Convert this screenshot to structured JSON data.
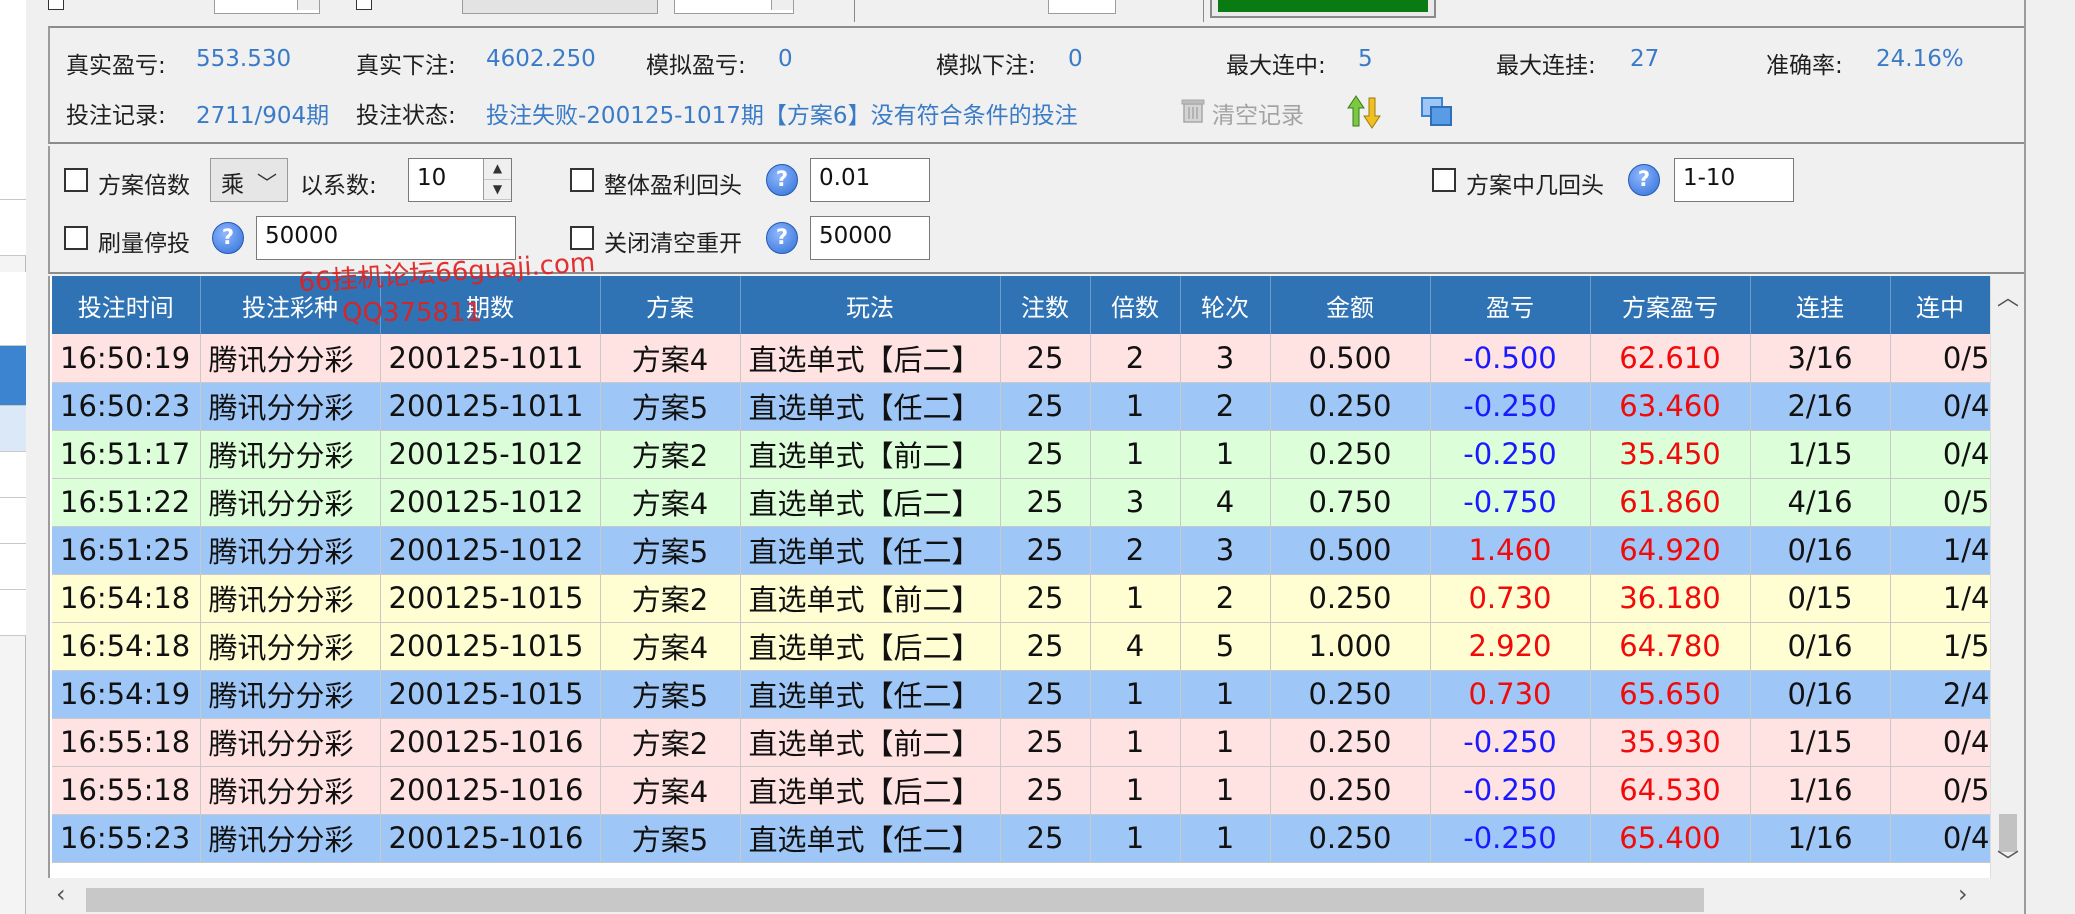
{
  "stats": {
    "real_pl_label": "真实盈亏:",
    "real_pl_value": "553.530",
    "real_bet_label": "真实下注:",
    "real_bet_value": "4602.250",
    "sim_pl_label": "模拟盈亏:",
    "sim_pl_value": "0",
    "sim_bet_label": "模拟下注:",
    "sim_bet_value": "0",
    "max_win_label": "最大连中:",
    "max_win_value": "5",
    "max_lose_label": "最大连挂:",
    "max_lose_value": "27",
    "accuracy_label": "准确率:",
    "accuracy_value": "24.16%",
    "record_label": "投注记录:",
    "record_value": "2711/904期",
    "status_label": "投注状态:",
    "status_value": "投注失败-200125-1017期【方案6】没有符合条件的投注",
    "clear_label": "清空记录"
  },
  "options": {
    "plan_multiplier_label": "方案倍数",
    "plan_multiplier_op": "乘",
    "coef_label": "以系数:",
    "coef_value": "10",
    "overall_profit_label": "整体盈利回头",
    "overall_profit_value": "0.01",
    "plan_hit_label": "方案中几回头",
    "plan_hit_value": "1-10",
    "volume_stop_label": "刷量停投",
    "volume_stop_value": "50000",
    "close_reset_label": "关闭清空重开",
    "close_reset_value": "50000",
    "help_glyph": "?"
  },
  "columns": [
    "投注时间",
    "投注彩种",
    "期数",
    "方案",
    "玩法",
    "注数",
    "倍数",
    "轮次",
    "金额",
    "盈亏",
    "方案盈亏",
    "连挂",
    "连中"
  ],
  "rows": [
    {
      "time": "16:50:19",
      "lottery": "腾讯分分彩",
      "period": "200125-1011",
      "plan": "方案4",
      "play": "直选单式【后二】",
      "count": "25",
      "mult": "2",
      "round": "3",
      "amount": "0.500",
      "pl": "-0.500",
      "plan_pl": "62.610",
      "lose": "3/16",
      "win": "0/5",
      "color": "pink"
    },
    {
      "time": "16:50:23",
      "lottery": "腾讯分分彩",
      "period": "200125-1011",
      "plan": "方案5",
      "play": "直选单式【任二】",
      "count": "25",
      "mult": "1",
      "round": "2",
      "amount": "0.250",
      "pl": "-0.250",
      "plan_pl": "63.460",
      "lose": "2/16",
      "win": "0/4",
      "color": "blue"
    },
    {
      "time": "16:51:17",
      "lottery": "腾讯分分彩",
      "period": "200125-1012",
      "plan": "方案2",
      "play": "直选单式【前二】",
      "count": "25",
      "mult": "1",
      "round": "1",
      "amount": "0.250",
      "pl": "-0.250",
      "plan_pl": "35.450",
      "lose": "1/15",
      "win": "0/4",
      "color": "green"
    },
    {
      "time": "16:51:22",
      "lottery": "腾讯分分彩",
      "period": "200125-1012",
      "plan": "方案4",
      "play": "直选单式【后二】",
      "count": "25",
      "mult": "3",
      "round": "4",
      "amount": "0.750",
      "pl": "-0.750",
      "plan_pl": "61.860",
      "lose": "4/16",
      "win": "0/5",
      "color": "green"
    },
    {
      "time": "16:51:25",
      "lottery": "腾讯分分彩",
      "period": "200125-1012",
      "plan": "方案5",
      "play": "直选单式【任二】",
      "count": "25",
      "mult": "2",
      "round": "3",
      "amount": "0.500",
      "pl": "1.460",
      "plan_pl": "64.920",
      "lose": "0/16",
      "win": "1/4",
      "color": "blue"
    },
    {
      "time": "16:54:18",
      "lottery": "腾讯分分彩",
      "period": "200125-1015",
      "plan": "方案2",
      "play": "直选单式【前二】",
      "count": "25",
      "mult": "1",
      "round": "2",
      "amount": "0.250",
      "pl": "0.730",
      "plan_pl": "36.180",
      "lose": "0/15",
      "win": "1/4",
      "color": "yellow"
    },
    {
      "time": "16:54:18",
      "lottery": "腾讯分分彩",
      "period": "200125-1015",
      "plan": "方案4",
      "play": "直选单式【后二】",
      "count": "25",
      "mult": "4",
      "round": "5",
      "amount": "1.000",
      "pl": "2.920",
      "plan_pl": "64.780",
      "lose": "0/16",
      "win": "1/5",
      "color": "yellow"
    },
    {
      "time": "16:54:19",
      "lottery": "腾讯分分彩",
      "period": "200125-1015",
      "plan": "方案5",
      "play": "直选单式【任二】",
      "count": "25",
      "mult": "1",
      "round": "1",
      "amount": "0.250",
      "pl": "0.730",
      "plan_pl": "65.650",
      "lose": "0/16",
      "win": "2/4",
      "color": "blue"
    },
    {
      "time": "16:55:18",
      "lottery": "腾讯分分彩",
      "period": "200125-1016",
      "plan": "方案2",
      "play": "直选单式【前二】",
      "count": "25",
      "mult": "1",
      "round": "1",
      "amount": "0.250",
      "pl": "-0.250",
      "plan_pl": "35.930",
      "lose": "1/15",
      "win": "0/4",
      "color": "pink"
    },
    {
      "time": "16:55:18",
      "lottery": "腾讯分分彩",
      "period": "200125-1016",
      "plan": "方案4",
      "play": "直选单式【后二】",
      "count": "25",
      "mult": "1",
      "round": "1",
      "amount": "0.250",
      "pl": "-0.250",
      "plan_pl": "64.530",
      "lose": "1/16",
      "win": "0/5",
      "color": "pink"
    },
    {
      "time": "16:55:23",
      "lottery": "腾讯分分彩",
      "period": "200125-1016",
      "plan": "方案5",
      "play": "直选单式【任二】",
      "count": "25",
      "mult": "1",
      "round": "1",
      "amount": "0.250",
      "pl": "-0.250",
      "plan_pl": "65.400",
      "lose": "1/16",
      "win": "0/4",
      "color": "blue"
    }
  ],
  "watermark": {
    "line1": "66挂机论坛66guaji.com",
    "line2": "QQ375811"
  },
  "colors": {
    "header_bg": "#2f73b5",
    "value_blue": "#3a7bc8",
    "loss_blue": "#1a1aff",
    "profit_red": "#f00a0a",
    "row_pink": "#ffe2e2",
    "row_blue": "#9ec7f7",
    "row_green": "#dcffd9",
    "row_yellow": "#fffdd2",
    "progress_green": "#0a7a12"
  }
}
